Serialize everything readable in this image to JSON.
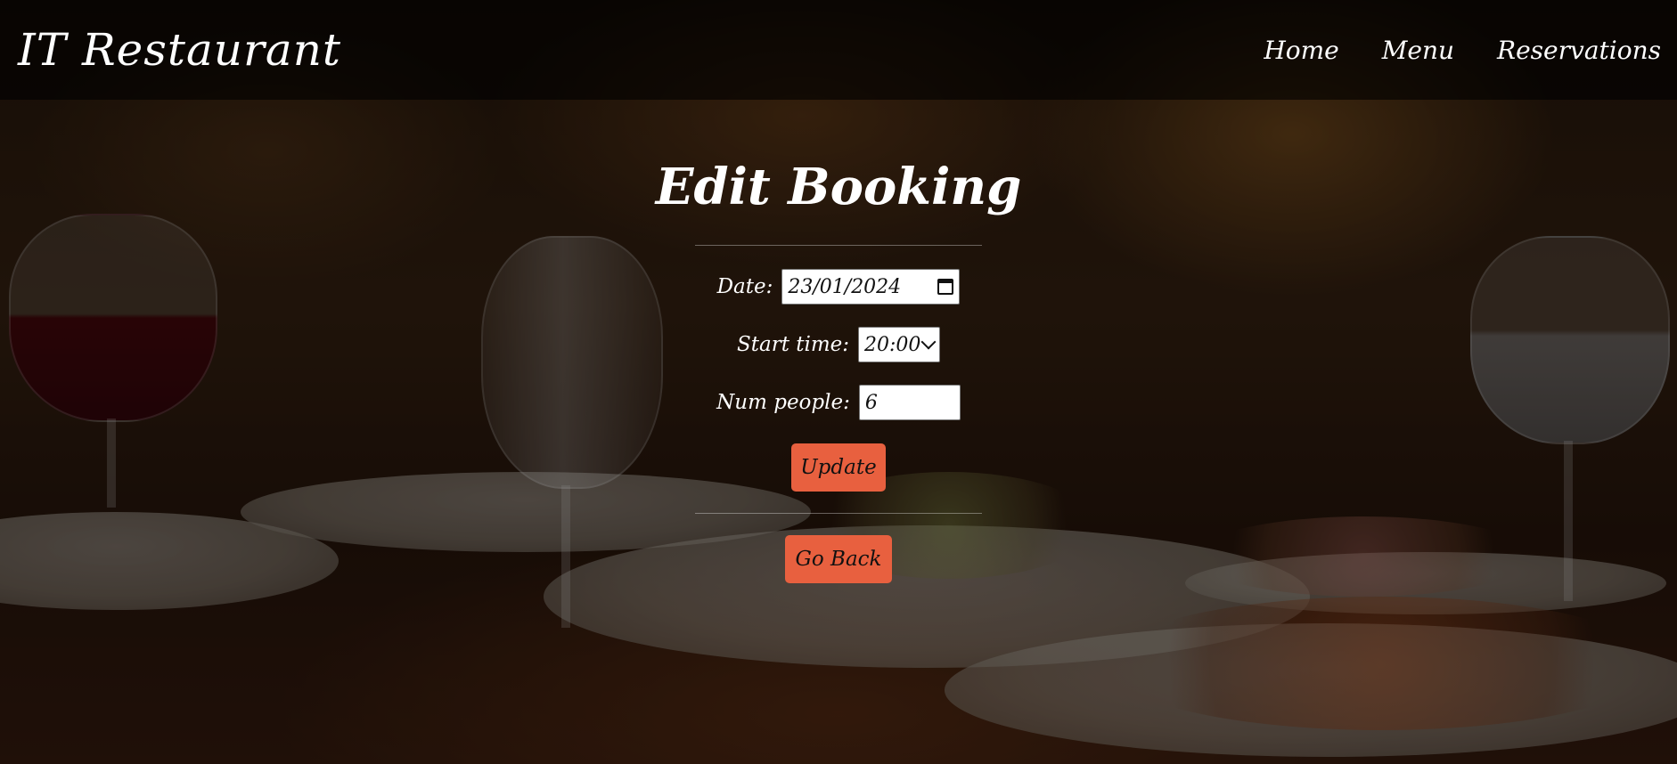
{
  "header": {
    "brand": "IT Restaurant",
    "nav": [
      "Home",
      "Menu",
      "Reservations"
    ]
  },
  "form": {
    "title": "Edit Booking",
    "date_label": "Date:",
    "date_value": "23/01/2024",
    "start_time_label": "Start time:",
    "start_time_value": "20:00",
    "num_people_label": "Num people:",
    "num_people_value": "6",
    "update_label": "Update",
    "go_back_label": "Go Back"
  },
  "colors": {
    "button": "#e8603f",
    "header_bg": "#000000"
  },
  "icons": {
    "date_icon": "calendar-icon",
    "time_icon": "chevron-down-icon"
  }
}
